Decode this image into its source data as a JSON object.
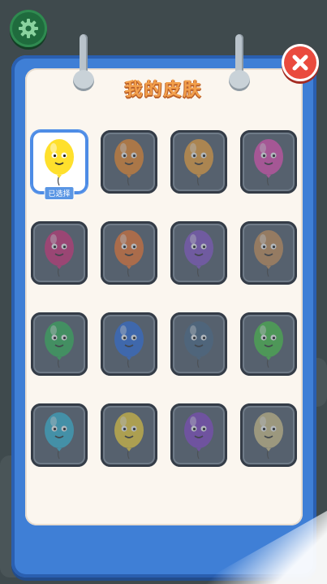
{
  "title": "我的皮肤",
  "selected_badge": "已选择",
  "colors": {
    "book": "#3f7fd6",
    "paper": "#fbf6ef",
    "close": "#ea4a3e",
    "title": "#f3a04c"
  },
  "skins": [
    {
      "id": "yellow-chick",
      "color": "#ffe02c",
      "state": "selected"
    },
    {
      "id": "orange-monster",
      "color": "#f08a2a",
      "state": "locked"
    },
    {
      "id": "orange-bird",
      "color": "#f2a43a",
      "state": "locked"
    },
    {
      "id": "pink-cat",
      "color": "#e64fb5",
      "state": "locked"
    },
    {
      "id": "pink-dots",
      "color": "#d2317a",
      "state": "locked"
    },
    {
      "id": "fox",
      "color": "#ef7630",
      "state": "locked"
    },
    {
      "id": "purple-striped",
      "color": "#8657c9",
      "state": "locked"
    },
    {
      "id": "bear",
      "color": "#c9925a",
      "state": "locked"
    },
    {
      "id": "green-dragon",
      "color": "#34b55a",
      "state": "locked"
    },
    {
      "id": "blue-monster",
      "color": "#2d6fe0",
      "state": "locked"
    },
    {
      "id": "penguin",
      "color": "#4a6a86",
      "state": "locked"
    },
    {
      "id": "green-frog",
      "color": "#49c447",
      "state": "locked"
    },
    {
      "id": "teal-monster",
      "color": "#36b8d6",
      "state": "locked"
    },
    {
      "id": "yellow-face",
      "color": "#f3d33a",
      "state": "locked"
    },
    {
      "id": "purple-grin",
      "color": "#8448c8",
      "state": "locked"
    },
    {
      "id": "old-man",
      "color": "#d6c58c",
      "state": "locked"
    }
  ]
}
